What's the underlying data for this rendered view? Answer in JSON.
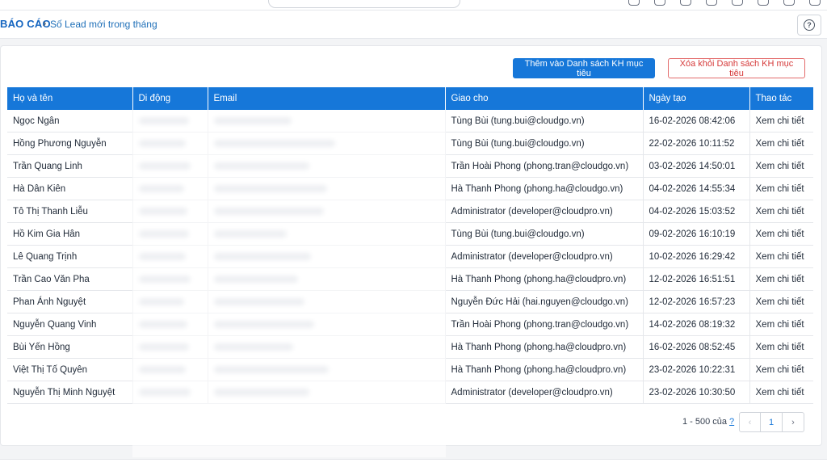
{
  "breadcrumb": {
    "root": "BÁO CÁO",
    "separator": "›",
    "current": "Số Lead mới trong tháng"
  },
  "help_label": "?",
  "actions": {
    "add_label": "Thêm vào Danh sách KH mục tiêu",
    "remove_label": "Xóa khỏi Danh sách KH mục tiêu"
  },
  "table": {
    "headers": [
      "Họ và tên",
      "Di động",
      "Email",
      "Giao cho",
      "Ngày tạo",
      "Thao tác"
    ],
    "rows": [
      {
        "name": "Ngọc Ngân",
        "assignee": "Tùng Bùi (tung.bui@cloudgo.vn)",
        "created": "16-02-2026 08:42:06",
        "action": "Xem chi tiết"
      },
      {
        "name": "Hồng Phương Nguyễn",
        "assignee": "Tùng Bùi (tung.bui@cloudgo.vn)",
        "created": "22-02-2026 10:11:52",
        "action": "Xem chi tiết"
      },
      {
        "name": "Trần Quang Linh",
        "assignee": "Trần Hoài Phong (phong.tran@cloudgo.vn)",
        "created": "03-02-2026 14:50:01",
        "action": "Xem chi tiết"
      },
      {
        "name": "Hà Dân Kiên",
        "assignee": "Hà Thanh Phong (phong.ha@cloudgo.vn)",
        "created": "04-02-2026 14:55:34",
        "action": "Xem chi tiết"
      },
      {
        "name": "Tô Thị Thanh Liễu",
        "assignee": "Administrator (developer@cloudpro.vn)",
        "created": "04-02-2026 15:03:52",
        "action": "Xem chi tiết"
      },
      {
        "name": "Hồ Kim Gia Hân",
        "assignee": "Tùng Bùi (tung.bui@cloudgo.vn)",
        "created": "09-02-2026 16:10:19",
        "action": "Xem chi tiết"
      },
      {
        "name": "Lê Quang Trịnh",
        "assignee": "Administrator (developer@cloudpro.vn)",
        "created": "10-02-2026 16:29:42",
        "action": "Xem chi tiết"
      },
      {
        "name": "Trần Cao Văn Pha",
        "assignee": "Hà Thanh Phong (phong.ha@cloudpro.vn)",
        "created": "12-02-2026 16:51:51",
        "action": "Xem chi tiết"
      },
      {
        "name": "Phan Ánh Nguyệt",
        "assignee": "Nguyễn Đức Hải (hai.nguyen@cloudgo.vn)",
        "created": "12-02-2026 16:57:23",
        "action": "Xem chi tiết"
      },
      {
        "name": "Nguyễn Quang Vinh",
        "assignee": "Trần Hoài Phong (phong.tran@cloudgo.vn)",
        "created": "14-02-2026 08:19:32",
        "action": "Xem chi tiết"
      },
      {
        "name": "Bùi Yến Hồng",
        "assignee": "Hà Thanh Phong (phong.ha@cloudpro.vn)",
        "created": "16-02-2026 08:52:45",
        "action": "Xem chi tiết"
      },
      {
        "name": "Việt Thị Tố Quyên",
        "assignee": "Hà Thanh Phong (phong.ha@cloudpro.vn)",
        "created": "23-02-2026 10:22:31",
        "action": "Xem chi tiết"
      },
      {
        "name": "Nguyễn Thị Minh Nguyệt",
        "assignee": "Administrator (developer@cloudpro.vn)",
        "created": "23-02-2026 10:30:50",
        "action": "Xem chi tiết"
      }
    ]
  },
  "pagination": {
    "range": "1 - 500 của",
    "total": "?",
    "current_page": "1",
    "prev": "‹",
    "next": "›"
  },
  "colors": {
    "primary": "#1677d9",
    "danger": "#d63a3a",
    "breadcrumb": "#1565c0"
  }
}
